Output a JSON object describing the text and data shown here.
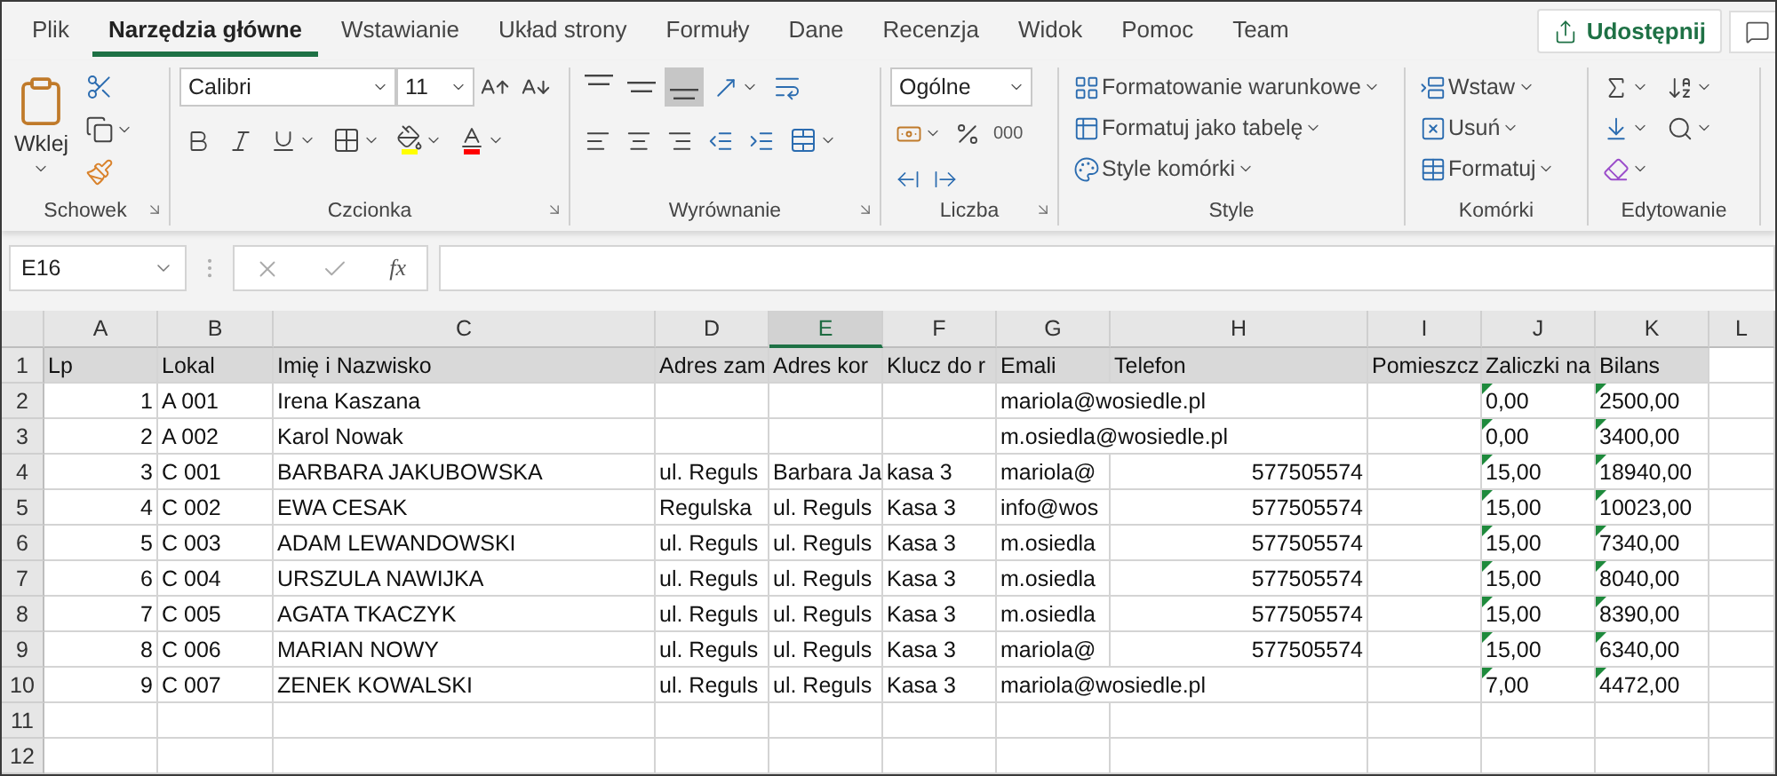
{
  "tabs": [
    {
      "label": "Plik",
      "selected": false
    },
    {
      "label": "Narzędzia główne",
      "selected": true
    },
    {
      "label": "Wstawianie",
      "selected": false
    },
    {
      "label": "Układ strony",
      "selected": false
    },
    {
      "label": "Formuły",
      "selected": false
    },
    {
      "label": "Dane",
      "selected": false
    },
    {
      "label": "Recenzja",
      "selected": false
    },
    {
      "label": "Widok",
      "selected": false
    },
    {
      "label": "Pomoc",
      "selected": false
    },
    {
      "label": "Team",
      "selected": false
    }
  ],
  "share_button": {
    "label": "Udostępnij"
  },
  "ribbon": {
    "clipboard": {
      "label": "Schowek",
      "paste": "Wklej"
    },
    "font": {
      "label": "Czcionka",
      "font_name": "Calibri",
      "font_size": "11"
    },
    "alignment": {
      "label": "Wyrównanie",
      "vertical": [
        {
          "kind": "top",
          "selected": false
        },
        {
          "kind": "middle",
          "selected": false
        },
        {
          "kind": "bottom",
          "selected": true
        }
      ]
    },
    "number": {
      "label": "Liczba",
      "format": "Ogólne",
      "thousands": "000"
    },
    "styles": {
      "label": "Style",
      "items": [
        {
          "kind": "conditional",
          "label": "Formatowanie warunkowe"
        },
        {
          "kind": "table",
          "label": "Formatuj jako tabelę"
        },
        {
          "kind": "cell",
          "label": "Style komórki"
        }
      ]
    },
    "cells": {
      "label": "Komórki",
      "items": [
        {
          "kind": "insert",
          "label": "Wstaw"
        },
        {
          "kind": "delete",
          "label": "Usuń"
        },
        {
          "kind": "format",
          "label": "Formatuj"
        }
      ]
    },
    "editing": {
      "label": "Edytowanie"
    }
  },
  "formula_bar": {
    "name_box": "E16",
    "fx": "fx"
  },
  "sheet": {
    "columns": [
      {
        "label": "A",
        "selected": false
      },
      {
        "label": "B",
        "selected": false
      },
      {
        "label": "C",
        "selected": false
      },
      {
        "label": "D",
        "selected": false
      },
      {
        "label": "E",
        "selected": true
      },
      {
        "label": "F",
        "selected": false
      },
      {
        "label": "G",
        "selected": false
      },
      {
        "label": "H",
        "selected": false
      },
      {
        "label": "I",
        "selected": false
      },
      {
        "label": "J",
        "selected": false
      },
      {
        "label": "K",
        "selected": false
      },
      {
        "label": "L",
        "selected": false
      }
    ],
    "rows": [
      {
        "header": "1",
        "kind": "header",
        "cells": [
          "Lp",
          "Lokal",
          "Imię i Nazwisko",
          "Adres zam",
          "Adres kor",
          "Klucz do r",
          "Emali",
          "Telefon",
          "Pomieszcz",
          "Zaliczki na",
          "Bilans"
        ]
      },
      {
        "header": "2",
        "kind": "data",
        "cells": [
          "1",
          "A 001",
          "Irena Kaszana",
          null,
          null,
          null,
          "mariola@wosiedle.pl",
          null,
          null,
          {
            "text": "0,00",
            "warning": true
          },
          {
            "text": "2500,00",
            "warning": true
          }
        ]
      },
      {
        "header": "3",
        "kind": "data",
        "cells": [
          "2",
          "A 002",
          "Karol Nowak",
          null,
          null,
          null,
          "m.osiedla@wosiedle.pl",
          null,
          null,
          {
            "text": "0,00",
            "warning": true
          },
          {
            "text": "3400,00",
            "warning": true
          }
        ]
      },
      {
        "header": "4",
        "kind": "data",
        "cells": [
          "3",
          "C 001",
          "BARBARA JAKUBOWSKA",
          "ul. Reguls",
          "Barbara Ja",
          "kasa 3",
          "mariola@",
          "577505574",
          null,
          {
            "text": "15,00",
            "warning": true
          },
          {
            "text": "18940,00",
            "warning": true
          }
        ]
      },
      {
        "header": "5",
        "kind": "data",
        "cells": [
          "4",
          "C 002",
          "EWA CESAK",
          "Regulska",
          "ul. Reguls",
          "Kasa 3",
          "info@wos",
          "577505574",
          null,
          {
            "text": "15,00",
            "warning": true
          },
          {
            "text": "10023,00",
            "warning": true
          }
        ]
      },
      {
        "header": "6",
        "kind": "data",
        "cells": [
          "5",
          "C 003",
          "ADAM LEWANDOWSKI",
          "ul. Reguls",
          "ul. Reguls",
          "Kasa 3",
          "m.osiedla",
          "577505574",
          null,
          {
            "text": "15,00",
            "warning": true
          },
          {
            "text": "7340,00",
            "warning": true
          }
        ]
      },
      {
        "header": "7",
        "kind": "data",
        "cells": [
          "6",
          "C 004",
          "URSZULA NAWIJKA",
          "ul. Reguls",
          "ul. Reguls",
          "Kasa 3",
          "m.osiedla",
          "577505574",
          null,
          {
            "text": "15,00",
            "warning": true
          },
          {
            "text": "8040,00",
            "warning": true
          }
        ]
      },
      {
        "header": "8",
        "kind": "data",
        "cells": [
          "7",
          "C 005",
          "AGATA TKACZYK",
          "ul. Reguls",
          "ul. Reguls",
          "Kasa 3",
          "m.osiedla",
          "577505574",
          null,
          {
            "text": "15,00",
            "warning": true
          },
          {
            "text": "8390,00",
            "warning": true
          }
        ]
      },
      {
        "header": "9",
        "kind": "data",
        "cells": [
          "8",
          "C 006",
          "MARIAN NOWY",
          "ul. Reguls",
          "ul. Reguls",
          "Kasa 3",
          "mariola@",
          "577505574",
          null,
          {
            "text": "15,00",
            "warning": true
          },
          {
            "text": "6340,00",
            "warning": true
          }
        ]
      },
      {
        "header": "10",
        "kind": "data",
        "cells": [
          "9",
          "C 007",
          "ZENEK KOWALSKI",
          "ul. Reguls",
          "ul. Reguls",
          "Kasa 3",
          "mariola@wosiedle.pl",
          null,
          null,
          {
            "text": "7,00",
            "warning": true
          },
          {
            "text": "4472,00",
            "warning": true
          }
        ]
      },
      {
        "header": "11",
        "kind": "data"
      },
      {
        "header": "12",
        "kind": "data"
      }
    ]
  }
}
